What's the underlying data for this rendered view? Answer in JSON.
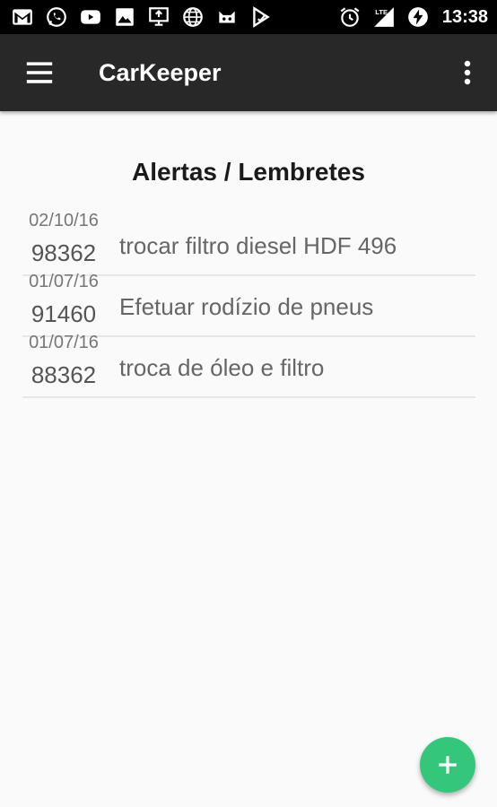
{
  "status_bar": {
    "time": "13:38",
    "left_icons": [
      "gmail-icon",
      "whatsapp-icon",
      "youtube-icon",
      "image-icon",
      "cast-icon",
      "globe-icon",
      "cyanogen-icon",
      "play-store-icon"
    ],
    "right_icons": [
      "alarm-icon",
      "lte-signal-icon",
      "battery-charging-icon"
    ]
  },
  "app_bar": {
    "title": "CarKeeper"
  },
  "main": {
    "section_title": "Alertas / Lembretes",
    "alerts": [
      {
        "date": "02/10/16",
        "km": "98362",
        "text": "trocar filtro diesel HDF 496"
      },
      {
        "date": "01/07/16",
        "km": "91460",
        "text": "Efetuar rodízio de pneus"
      },
      {
        "date": "01/07/16",
        "km": "88362",
        "text": "troca de óleo e filtro"
      }
    ]
  },
  "colors": {
    "app_bar": "#282828",
    "status_bar": "#000000",
    "fab": "#34c77b",
    "background": "#fafafa"
  }
}
